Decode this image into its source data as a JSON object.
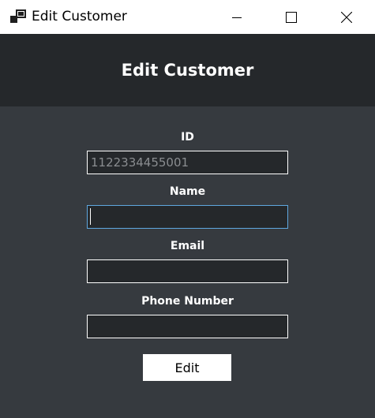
{
  "window": {
    "title": "Edit Customer",
    "icon": "app-window-icon",
    "controls": [
      "minimize-icon",
      "maximize-icon",
      "close-icon"
    ]
  },
  "header": {
    "title": "Edit Customer"
  },
  "form": {
    "id": {
      "label": "ID",
      "value": "1122334455001",
      "readonly": true
    },
    "name": {
      "label": "Name",
      "value": "",
      "focused": true
    },
    "email": {
      "label": "Email",
      "value": ""
    },
    "phone": {
      "label": "Phone Number",
      "value": ""
    }
  },
  "actions": {
    "edit_label": "Edit"
  },
  "colors": {
    "titlebar_bg": "#ffffff",
    "header_bg": "#25282b",
    "body_bg": "#363a3f",
    "input_bg": "#25282b",
    "input_border": "#ffffff",
    "focus_border": "#5fa8e0",
    "readonly_text": "#8a8d90"
  }
}
